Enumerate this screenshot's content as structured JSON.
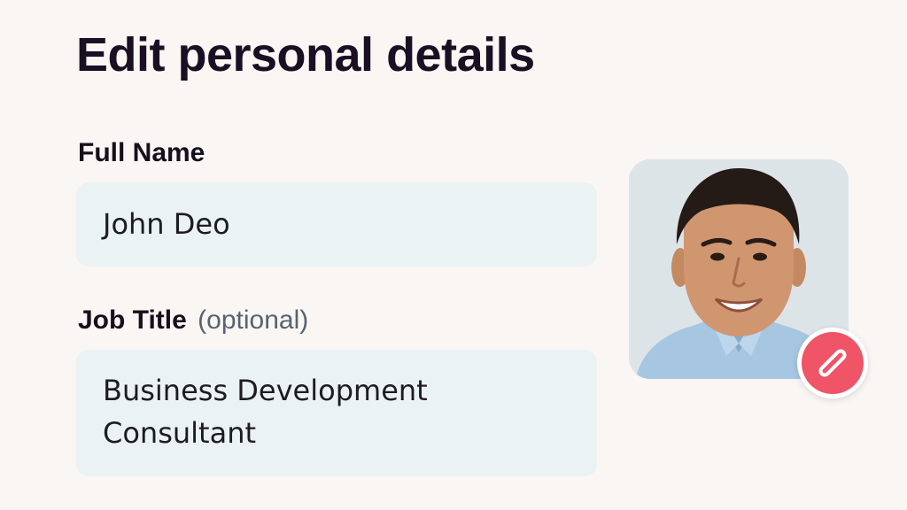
{
  "page": {
    "title": "Edit personal details"
  },
  "form": {
    "full_name": {
      "label": "Full Name",
      "value": "John Deo"
    },
    "job_title": {
      "label": "Job Title",
      "label_suffix": "(optional)",
      "value": "Business Development Consultant"
    }
  },
  "profile_photo": {
    "edit_icon": "pencil-icon"
  },
  "colors": {
    "background": "#faf6f4",
    "title_text": "#1a1024",
    "field_background": "#ebf2f4",
    "accent": "#ef5467",
    "muted_text": "#566370"
  }
}
